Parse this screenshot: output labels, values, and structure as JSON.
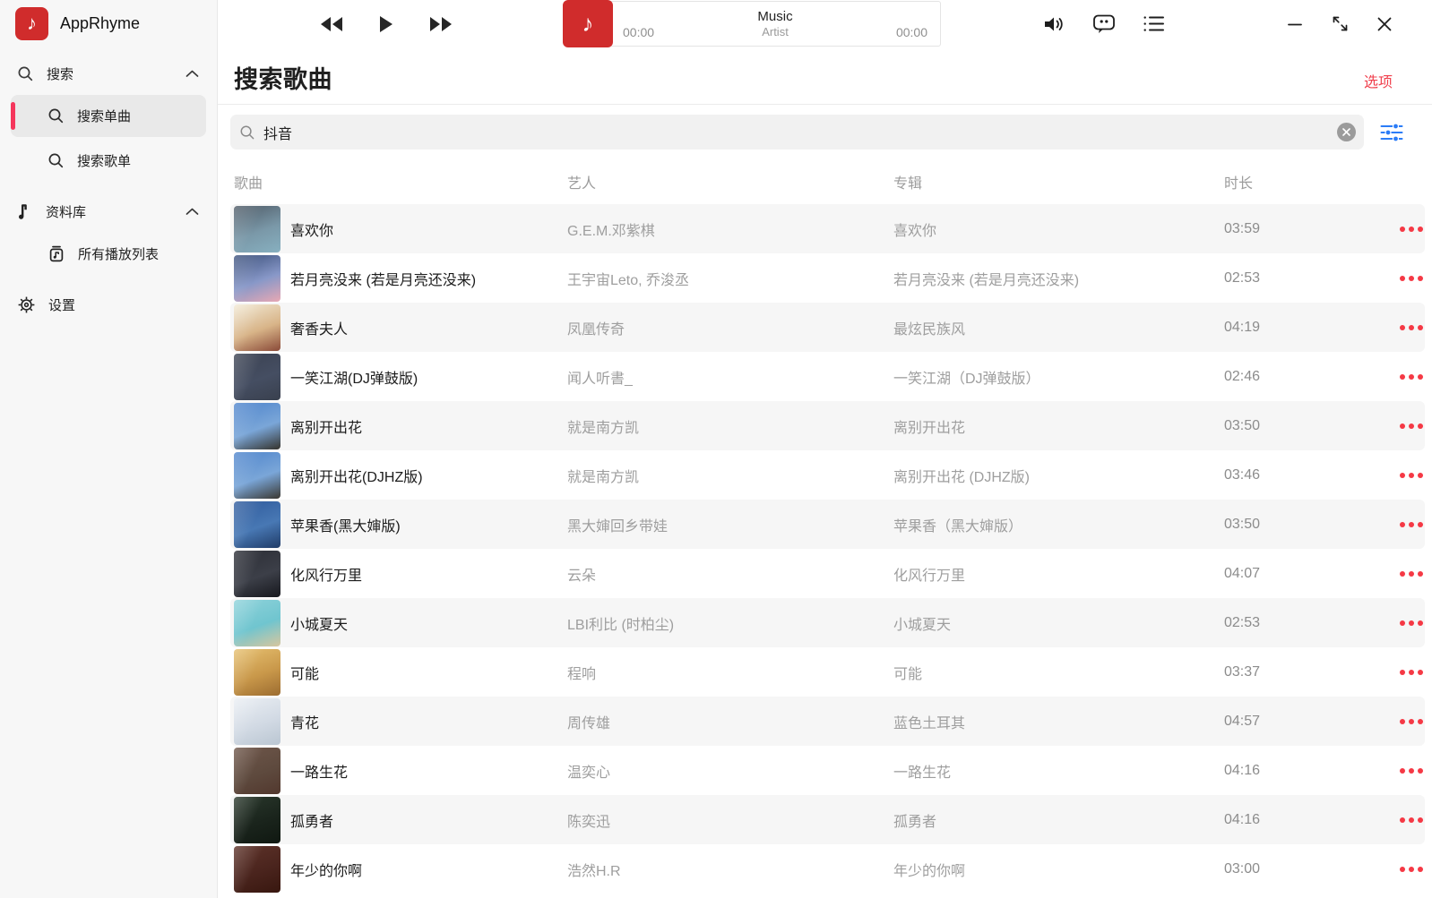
{
  "app": {
    "name": "AppRhyme"
  },
  "sidebar": {
    "search_group": {
      "label": "搜索",
      "items": [
        {
          "label": "搜索单曲",
          "selected": true
        },
        {
          "label": "搜索歌单",
          "selected": false
        }
      ]
    },
    "library_group": {
      "label": "资料库",
      "items": [
        {
          "label": "所有播放列表"
        }
      ]
    },
    "settings_label": "设置"
  },
  "player": {
    "title": "Music",
    "artist": "Artist",
    "elapsed": "00:00",
    "duration": "00:00"
  },
  "page": {
    "title": "搜索歌曲",
    "options_label": "选项"
  },
  "search": {
    "query": "抖音",
    "placeholder": ""
  },
  "table": {
    "columns": [
      "歌曲",
      "艺人",
      "专辑",
      "时长"
    ],
    "rows": [
      {
        "title": "喜欢你",
        "artist": "G.E.M.邓紫棋",
        "album": "喜欢你",
        "duration": "03:59",
        "art": [
          "#4e5a66",
          "#7a98a8",
          "#87b0c0"
        ]
      },
      {
        "title": "若月亮没来 (若是月亮还没来)",
        "artist": "王宇宙Leto, 乔浚丞",
        "album": "若月亮没来 (若是月亮还没来)",
        "duration": "02:53",
        "art": [
          "#3a4f7a",
          "#8898c8",
          "#e8a8b4"
        ]
      },
      {
        "title": "奢香夫人",
        "artist": "凤凰传奇",
        "album": "最炫民族风",
        "duration": "04:19",
        "art": [
          "#f2ead6",
          "#d8b488",
          "#8a4a38"
        ]
      },
      {
        "title": "一笑江湖(DJ弹鼓版)",
        "artist": "闻人听書_",
        "album": "一笑江湖（DJ弹鼓版）",
        "duration": "02:46",
        "art": [
          "#3b4252",
          "#454e62",
          "#39404e"
        ]
      },
      {
        "title": "离别开出花",
        "artist": "就是南方凯",
        "album": "离别开出花",
        "duration": "03:50",
        "art": [
          "#4e84cc",
          "#7aa6d8",
          "#35332c"
        ]
      },
      {
        "title": "离别开出花(DJHZ版)",
        "artist": "就是南方凯",
        "album": "离别开出花 (DJHZ版)",
        "duration": "03:46",
        "art": [
          "#4e84cc",
          "#7aa6d8",
          "#3a3831"
        ]
      },
      {
        "title": "苹果香(黑大婶版)",
        "artist": "黑大婶回乡带娃",
        "album": "苹果香（黑大婶版）",
        "duration": "03:50",
        "art": [
          "#2e5a9c",
          "#4878b4",
          "#203c68"
        ]
      },
      {
        "title": "化风行万里",
        "artist": "云朵",
        "album": "化风行万里",
        "duration": "04:07",
        "art": [
          "#2b2d35",
          "#3c3f48",
          "#17181e"
        ]
      },
      {
        "title": "小城夏天",
        "artist": "LBI利比 (时柏尘)",
        "album": "小城夏天",
        "duration": "02:53",
        "art": [
          "#8ed2da",
          "#70c5cf",
          "#d8c69e"
        ]
      },
      {
        "title": "可能",
        "artist": "程响",
        "album": "可能",
        "duration": "03:37",
        "art": [
          "#e6c070",
          "#c9984a",
          "#9c6c30"
        ]
      },
      {
        "title": "青花",
        "artist": "周传雄",
        "album": "蓝色土耳其",
        "duration": "04:57",
        "art": [
          "#eaeef3",
          "#d2dae4",
          "#bac6d2"
        ]
      },
      {
        "title": "一路生花",
        "artist": "温奕心",
        "album": "一路生花",
        "duration": "04:16",
        "art": [
          "#6e564a",
          "#5e4a3e",
          "#52382e"
        ]
      },
      {
        "title": "孤勇者",
        "artist": "陈奕迅",
        "album": "孤勇者",
        "duration": "04:16",
        "art": [
          "#2a382c",
          "#1a241c",
          "#101811"
        ]
      },
      {
        "title": "年少的你啊",
        "artist": "浩然H.R",
        "album": "年少的你啊",
        "duration": "03:00",
        "art": [
          "#5e332a",
          "#4a241d",
          "#38170f"
        ]
      }
    ]
  },
  "colors": {
    "accent_red": "#d02c2c",
    "menu_dot_red": "#f53945",
    "link_red": "#f0404d",
    "selected_bar_red": "#f5365c",
    "filter_blue": "#2b7cf7",
    "stripe_gray": "#f6f6f6",
    "sidebar_gray": "#f7f7f7"
  }
}
